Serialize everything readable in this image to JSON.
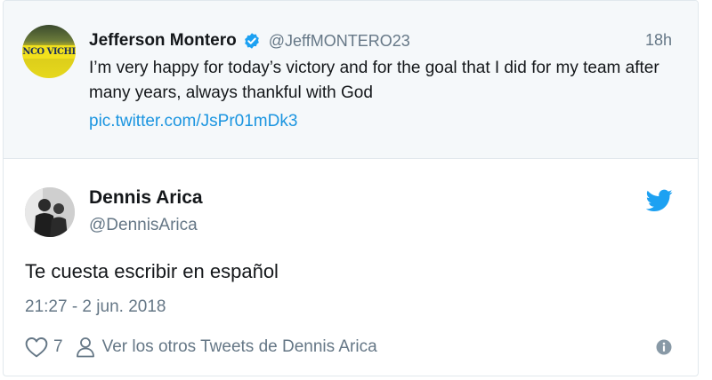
{
  "quoted_tweet": {
    "display_name": "Jefferson Montero",
    "handle": "@JeffMONTERO23",
    "time": "18h",
    "text": "I’m very happy for today’s victory and for the goal that I did for my team after many years, always thankful with God",
    "link": "pic.twitter.com/JsPr01mDk3",
    "avatar_text": "NCO VICHI",
    "verified_icon": "verified-badge-icon"
  },
  "reply_tweet": {
    "display_name": "Dennis Arica",
    "handle": "@DennisArica",
    "text": "Te cuesta escribir en español",
    "timestamp": "21:27 - 2 jun. 2018",
    "like_count": "7",
    "view_more_label": "Ver los otros Tweets de Dennis Arica",
    "icons": [
      "twitter-bird-icon",
      "heart-icon",
      "person-icon",
      "info-icon"
    ]
  },
  "colors": {
    "accent": "#1b95e0",
    "muted": "#657786",
    "text": "#14171a",
    "quoted_bg": "#f5f8fa"
  }
}
